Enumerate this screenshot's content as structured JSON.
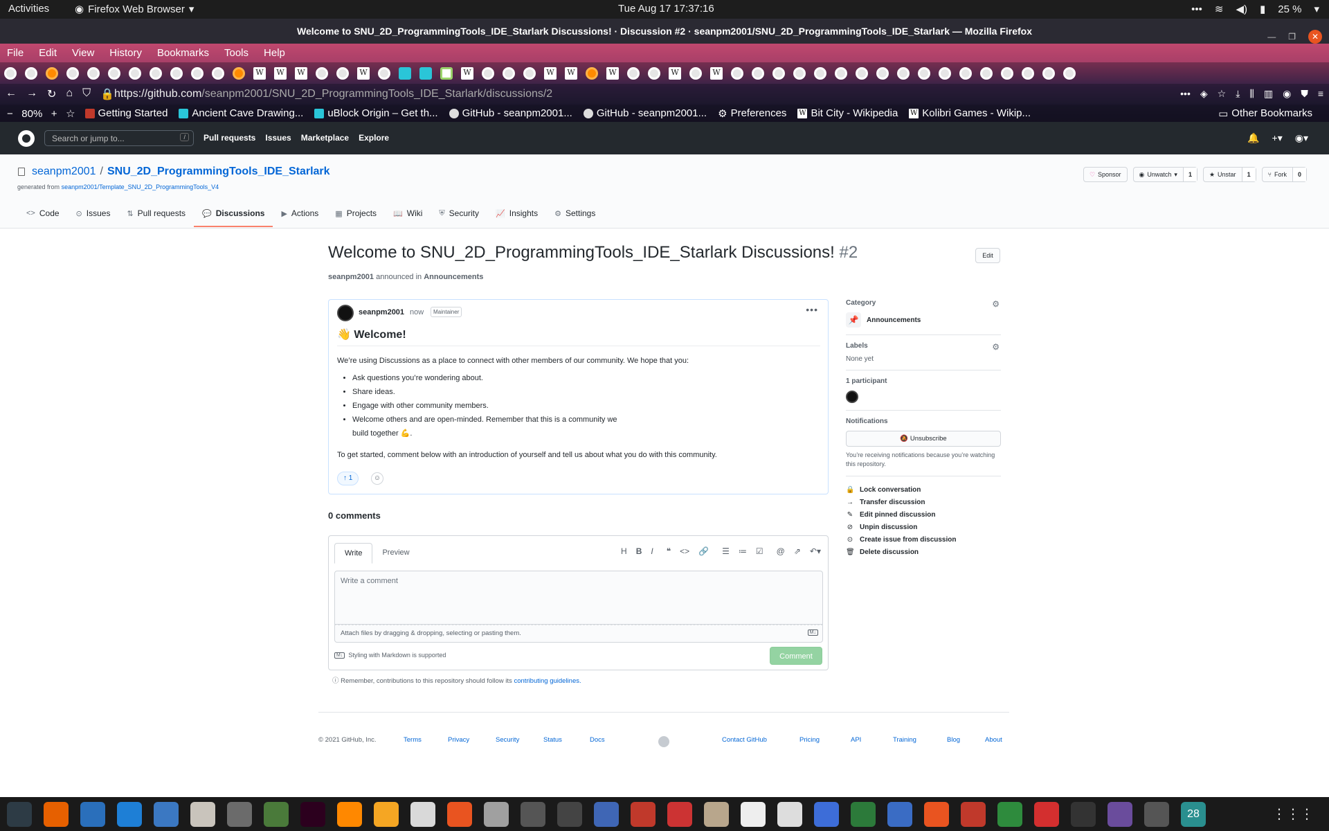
{
  "gnome": {
    "activities": "Activities",
    "app_menu": "Firefox Web Browser",
    "clock": "Tue Aug 17  17:37:16",
    "battery": "25 %"
  },
  "window": {
    "title": "Welcome to SNU_2D_ProgrammingTools_IDE_Starlark Discussions! · Discussion #2 · seanpm2001/SNU_2D_ProgrammingTools_IDE_Starlark — Mozilla Firefox"
  },
  "menubar": [
    "File",
    "Edit",
    "View",
    "History",
    "Bookmarks",
    "Tools",
    "Help"
  ],
  "tab_icons": [
    "github",
    "github",
    "firefox",
    "github",
    "github",
    "github",
    "github",
    "github",
    "github",
    "github",
    "github",
    "firefox",
    "wikipedia",
    "wikipedia",
    "wikipedia",
    "github",
    "github",
    "wikipedia",
    "github",
    "cyan",
    "cyan",
    "puzzle",
    "wikipedia",
    "github",
    "github",
    "github",
    "wikipedia",
    "wikipedia",
    "firefox",
    "wikipedia",
    "github",
    "github",
    "wikipedia",
    "github",
    "wikipedia",
    "github",
    "github",
    "github",
    "github",
    "github",
    "github",
    "github",
    "github",
    "github",
    "github",
    "github",
    "github",
    "github",
    "github",
    "github",
    "github",
    "github"
  ],
  "navbar": {
    "url_prefix": "https://github.com",
    "url_rest": "/seanpm2001/SNU_2D_ProgrammingTools_IDE_Starlark/discussions/2"
  },
  "bookmarks": {
    "zoom": "80%",
    "items": [
      {
        "label": "Getting Started",
        "icon": "firefox"
      },
      {
        "label": "Ancient Cave Drawing...",
        "icon": "cyan"
      },
      {
        "label": "uBlock Origin – Get th...",
        "icon": "cyan"
      },
      {
        "label": "GitHub - seanpm2001...",
        "icon": "github"
      },
      {
        "label": "GitHub - seanpm2001...",
        "icon": "github"
      },
      {
        "label": "Preferences",
        "icon": "gear"
      },
      {
        "label": "Bit City - Wikipedia",
        "icon": "wikipedia"
      },
      {
        "label": "Kolibri Games - Wikip...",
        "icon": "wikipedia"
      }
    ],
    "other": "Other Bookmarks"
  },
  "github_header": {
    "search_placeholder": "Search or jump to...",
    "search_key": "/",
    "nav": [
      "Pull requests",
      "Issues",
      "Marketplace",
      "Explore"
    ]
  },
  "repo": {
    "owner": "seanpm2001",
    "separator": "/",
    "name": "SNU_2D_ProgrammingTools_IDE_Starlark",
    "generated_prefix": "generated from",
    "generated_link": "seanpm2001/Template_SNU_2D_ProgrammingTools_V4",
    "actions": {
      "sponsor": "Sponsor",
      "watch": "Unwatch",
      "watch_count": "1",
      "star": "Unstar",
      "star_count": "1",
      "fork": "Fork",
      "fork_count": "0"
    },
    "tabs": [
      {
        "label": "Code",
        "icon": "<>"
      },
      {
        "label": "Issues",
        "icon": "⊙"
      },
      {
        "label": "Pull requests",
        "icon": "⇅"
      },
      {
        "label": "Discussions",
        "icon": "💬"
      },
      {
        "label": "Actions",
        "icon": "▶"
      },
      {
        "label": "Projects",
        "icon": "▦"
      },
      {
        "label": "Wiki",
        "icon": "📖"
      },
      {
        "label": "Security",
        "icon": "⛨"
      },
      {
        "label": "Insights",
        "icon": "📈"
      },
      {
        "label": "Settings",
        "icon": "⚙"
      }
    ],
    "active_tab": "Discussions"
  },
  "discussion": {
    "title": "Welcome to SNU_2D_ProgrammingTools_IDE_Starlark Discussions!",
    "number": "#2",
    "edit": "Edit",
    "meta_author": "seanpm2001",
    "meta_text": "announced in",
    "meta_category": "Announcements",
    "post": {
      "author": "seanpm2001",
      "time": "now",
      "badge": "Maintainer",
      "heading": "👋 Welcome!",
      "intro": "We’re using Discussions as a place to connect with other members of our community. We hope that you:",
      "bullets": [
        "Ask questions you’re wondering about.",
        "Share ideas.",
        "Engage with other community members.",
        "Welcome others and are open-minded. Remember that this is a community we build together 💪."
      ],
      "outro": "To get started, comment below with an introduction of yourself and tell us about what you do with this community.",
      "reaction": "↑ 1"
    },
    "comments_count": "0 comments"
  },
  "sidebar": {
    "category_label": "Category",
    "category_value": "Announcements",
    "labels_label": "Labels",
    "labels_value": "None yet",
    "participants_label": "1 participant",
    "notifications_label": "Notifications",
    "unsubscribe": "Unsubscribe",
    "notify_note": "You’re receiving notifications because you’re watching this repository.",
    "actions": [
      {
        "label": "Lock conversation",
        "icon": "🔒"
      },
      {
        "label": "Transfer discussion",
        "icon": "→"
      },
      {
        "label": "Edit pinned discussion",
        "icon": "✎"
      },
      {
        "label": "Unpin discussion",
        "icon": "⊘"
      },
      {
        "label": "Create issue from discussion",
        "icon": "⊙"
      },
      {
        "label": "Delete discussion",
        "icon": "🗑"
      }
    ]
  },
  "comment_box": {
    "tab_write": "Write",
    "tab_preview": "Preview",
    "placeholder": "Write a comment",
    "attach": "Attach files by dragging & dropping, selecting or pasting them.",
    "markdown_note": "Styling with Markdown is supported",
    "submit": "Comment",
    "reminder_text": "Remember, contributions to this repository should follow its",
    "reminder_link": "contributing guidelines."
  },
  "footer": {
    "copyright": "© 2021 GitHub, Inc.",
    "left_links": [
      "Terms",
      "Privacy",
      "Security",
      "Status",
      "Docs"
    ],
    "right_links": [
      "Contact GitHub",
      "Pricing",
      "API",
      "Training",
      "Blog",
      "About"
    ]
  },
  "dock": [
    {
      "name": "system-monitor",
      "color": "#2d3b45"
    },
    {
      "name": "firefox",
      "color": "#e66000"
    },
    {
      "name": "writer",
      "color": "#2a6fbb"
    },
    {
      "name": "help",
      "color": "#1e7fd6"
    },
    {
      "name": "text-editor",
      "color": "#3b78c2"
    },
    {
      "name": "files",
      "color": "#c9c4bc"
    },
    {
      "name": "settings",
      "color": "#6b6b6b"
    },
    {
      "name": "minecraft",
      "color": "#4a7a3a"
    },
    {
      "name": "terminal",
      "color": "#2c001e"
    },
    {
      "name": "vlc",
      "color": "#ff8800"
    },
    {
      "name": "calc",
      "color": "#f5a623"
    },
    {
      "name": "monitor",
      "color": "#d9d9d9"
    },
    {
      "name": "software",
      "color": "#e95420"
    },
    {
      "name": "image-viewer",
      "color": "#a0a0a0"
    },
    {
      "name": "disk",
      "color": "#555"
    },
    {
      "name": "inkscape",
      "color": "#444"
    },
    {
      "name": "reader",
      "color": "#3f66b5"
    },
    {
      "name": "screenshot",
      "color": "#c0392b"
    },
    {
      "name": "font-viewer",
      "color": "#c33"
    },
    {
      "name": "archive",
      "color": "#b8a68c"
    },
    {
      "name": "char-map",
      "color": "#eee"
    },
    {
      "name": "dictionary",
      "color": "#ddd"
    },
    {
      "name": "todo",
      "color": "#3d6dd8"
    },
    {
      "name": "vim",
      "color": "#2c7a3a"
    },
    {
      "name": "remote",
      "color": "#3a6cc4"
    },
    {
      "name": "update",
      "color": "#e95420"
    },
    {
      "name": "mario",
      "color": "#c0392b"
    },
    {
      "name": "spreadsheet",
      "color": "#2e8b3d"
    },
    {
      "name": "alert",
      "color": "#d32f2f"
    },
    {
      "name": "music",
      "color": "#333"
    },
    {
      "name": "obs",
      "color": "#6a4c9c"
    },
    {
      "name": "gimp",
      "color": "#555"
    },
    {
      "name": "calendar",
      "color": "#2a8f8f"
    }
  ],
  "dock_calendar_day": "28"
}
